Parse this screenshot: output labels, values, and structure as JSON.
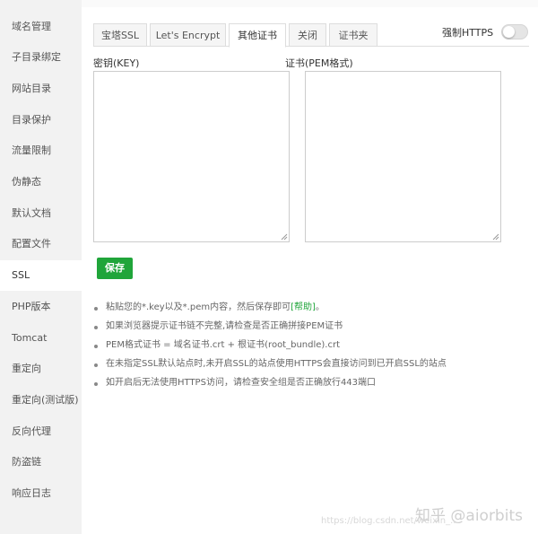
{
  "sidebar": {
    "items": [
      {
        "label": "域名管理"
      },
      {
        "label": "子目录绑定"
      },
      {
        "label": "网站目录"
      },
      {
        "label": "目录保护"
      },
      {
        "label": "流量限制"
      },
      {
        "label": "伪静态"
      },
      {
        "label": "默认文档"
      },
      {
        "label": "配置文件"
      },
      {
        "label": "SSL"
      },
      {
        "label": "PHP版本"
      },
      {
        "label": "Tomcat"
      },
      {
        "label": "重定向"
      },
      {
        "label": "重定向(测试版)"
      },
      {
        "label": "反向代理"
      },
      {
        "label": "防盗链"
      },
      {
        "label": "响应日志"
      }
    ],
    "active_index": 8
  },
  "tabs": [
    {
      "label": "宝塔SSL"
    },
    {
      "label": "Let's Encrypt"
    },
    {
      "label": "其他证书"
    },
    {
      "label": "关闭"
    },
    {
      "label": "证书夹"
    }
  ],
  "active_tab_index": 2,
  "force_https": {
    "label": "强制HTTPS",
    "enabled": false
  },
  "key_field": {
    "label": "密钥(KEY)",
    "value": ""
  },
  "cert_field": {
    "label": "证书(PEM格式)",
    "value": ""
  },
  "save_button": {
    "label": "保存"
  },
  "tips": [
    {
      "text": "粘贴您的*.key以及*.pem内容，然后保存即可",
      "link": "[帮助]",
      "suffix": "。"
    },
    {
      "text": "如果浏览器提示证书链不完整,请检查是否正确拼接PEM证书"
    },
    {
      "text": "PEM格式证书 = 域名证书.crt + 根证书(root_bundle).crt"
    },
    {
      "text": "在未指定SSL默认站点时,未开启SSL的站点使用HTTPS会直接访问到已开启SSL的站点"
    },
    {
      "text": "如开启后无法使用HTTPS访问，请检查安全组是否正确放行443端口"
    }
  ],
  "colors": {
    "accent": "#20a53a",
    "sidebar_bg": "#f2f2f2",
    "border": "#dddddd"
  },
  "watermark": {
    "logo": "知乎 @aiorbits",
    "url": "https://blog.csdn.net/weixin_..."
  }
}
